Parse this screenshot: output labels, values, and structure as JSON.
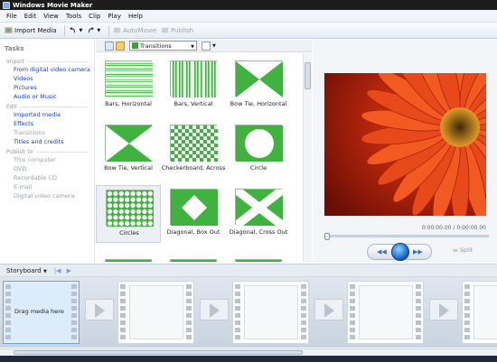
{
  "window": {
    "title": "Windows Movie Maker"
  },
  "menu": [
    "File",
    "Edit",
    "View",
    "Tools",
    "Clip",
    "Play",
    "Help"
  ],
  "toolbar": {
    "import_media": "Import Media",
    "automovie": "AutoMovie",
    "publish": "Publish"
  },
  "tasks": {
    "header": "Tasks",
    "sections": [
      {
        "caption": "Import",
        "items": [
          {
            "label": "From digital video camera",
            "enabled": true
          },
          {
            "label": "Videos",
            "enabled": true
          },
          {
            "label": "Pictures",
            "enabled": true
          },
          {
            "label": "Audio or Music",
            "enabled": true
          }
        ]
      },
      {
        "caption": "Edit",
        "items": [
          {
            "label": "Imported media",
            "enabled": true
          },
          {
            "label": "Effects",
            "enabled": true
          },
          {
            "label": "Transitions",
            "enabled": false
          },
          {
            "label": "Titles and credits",
            "enabled": true
          }
        ]
      },
      {
        "caption": "Publish to",
        "items": [
          {
            "label": "This computer",
            "enabled": false
          },
          {
            "label": "DVD",
            "enabled": false
          },
          {
            "label": "Recordable CD",
            "enabled": false
          },
          {
            "label": "E-mail",
            "enabled": false
          },
          {
            "label": "Digital video camera",
            "enabled": false
          }
        ]
      }
    ]
  },
  "content": {
    "dropdown_value": "Transitions"
  },
  "transitions": [
    {
      "label": "Bars, Horizontal",
      "pattern": "bars-horizontal"
    },
    {
      "label": "Bars, Vertical",
      "pattern": "bars-vertical"
    },
    {
      "label": "Bow Tie, Horizontal",
      "pattern": "bowtie-horizontal"
    },
    {
      "label": "Bow Tie, Vertical",
      "pattern": "bowtie-vertical"
    },
    {
      "label": "Checkerboard, Across",
      "pattern": "checkerboard"
    },
    {
      "label": "Circle",
      "pattern": "circle"
    },
    {
      "label": "Circles",
      "pattern": "circles",
      "selected": true
    },
    {
      "label": "Diagonal, Box Out",
      "pattern": "diagonal-box"
    },
    {
      "label": "Diagonal, Cross Out",
      "pattern": "diagonal-cross"
    }
  ],
  "player": {
    "time": "0:00:00.00 / 0:00:00.00",
    "split": "Split",
    "preview_subject": "red gerbera flower"
  },
  "storyboard": {
    "label": "Storyboard",
    "drag_hint": "Drag media here"
  }
}
